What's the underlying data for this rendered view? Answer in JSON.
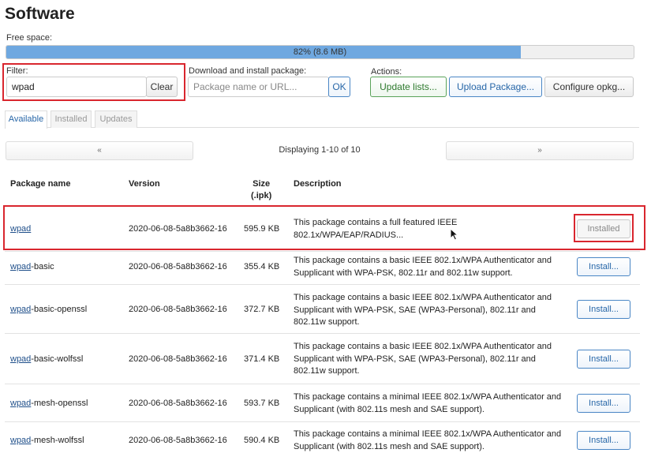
{
  "page_title": "Software",
  "free_space": {
    "label": "Free space:",
    "text": "82% (8.6 MB)",
    "percent": 82
  },
  "filter": {
    "label": "Filter:",
    "value": "wpad",
    "clear_label": "Clear"
  },
  "download": {
    "label": "Download and install package:",
    "placeholder": "Package name or URL...",
    "ok_label": "OK"
  },
  "actions": {
    "label": "Actions:",
    "update_label": "Update lists...",
    "upload_label": "Upload Package...",
    "configure_label": "Configure opkg..."
  },
  "tabs": [
    "Available",
    "Installed",
    "Updates"
  ],
  "pager": {
    "prev": "«",
    "next": "»",
    "text": "Displaying 1-10 of 10"
  },
  "columns": {
    "name": "Package name",
    "version": "Version",
    "size": "Size\n(.ipk)",
    "description": "Description"
  },
  "packages": [
    {
      "prefix": "wpad",
      "suffix": "",
      "version": "2020-06-08-5a8b3662-16",
      "size": "595.9 KB",
      "description": "This package contains a full featured IEEE 802.1x/WPA/EAP/RADIUS...",
      "action": "Installed"
    },
    {
      "prefix": "wpad",
      "suffix": "-basic",
      "version": "2020-06-08-5a8b3662-16",
      "size": "355.4 KB",
      "description": "This package contains a basic IEEE 802.1x/WPA Authenticator and Supplicant with WPA-PSK, 802.11r and 802.11w support.",
      "action": "Install..."
    },
    {
      "prefix": "wpad",
      "suffix": "-basic-openssl",
      "version": "2020-06-08-5a8b3662-16",
      "size": "372.7 KB",
      "description": "This package contains a basic IEEE 802.1x/WPA Authenticator and Supplicant with WPA-PSK, SAE (WPA3-Personal), 802.11r and 802.11w support.",
      "action": "Install..."
    },
    {
      "prefix": "wpad",
      "suffix": "-basic-wolfssl",
      "version": "2020-06-08-5a8b3662-16",
      "size": "371.4 KB",
      "description": "This package contains a basic IEEE 802.1x/WPA Authenticator and Supplicant with WPA-PSK, SAE (WPA3-Personal), 802.11r and 802.11w support.",
      "action": "Install..."
    },
    {
      "prefix": "wpad",
      "suffix": "-mesh-openssl",
      "version": "2020-06-08-5a8b3662-16",
      "size": "593.7 KB",
      "description": "This package contains a minimal IEEE 802.1x/WPA Authenticator and Supplicant (with 802.11s mesh and SAE support).",
      "action": "Install..."
    },
    {
      "prefix": "wpad",
      "suffix": "-mesh-wolfssl",
      "version": "2020-06-08-5a8b3662-16",
      "size": "590.4 KB",
      "description": "This package contains a minimal IEEE 802.1x/WPA Authenticator and Supplicant (with 802.11s mesh and SAE support).",
      "action": "Install..."
    }
  ],
  "colors": {
    "accent": "#2867a8",
    "progress": "#6fa8e0",
    "highlight": "#d9262e"
  }
}
